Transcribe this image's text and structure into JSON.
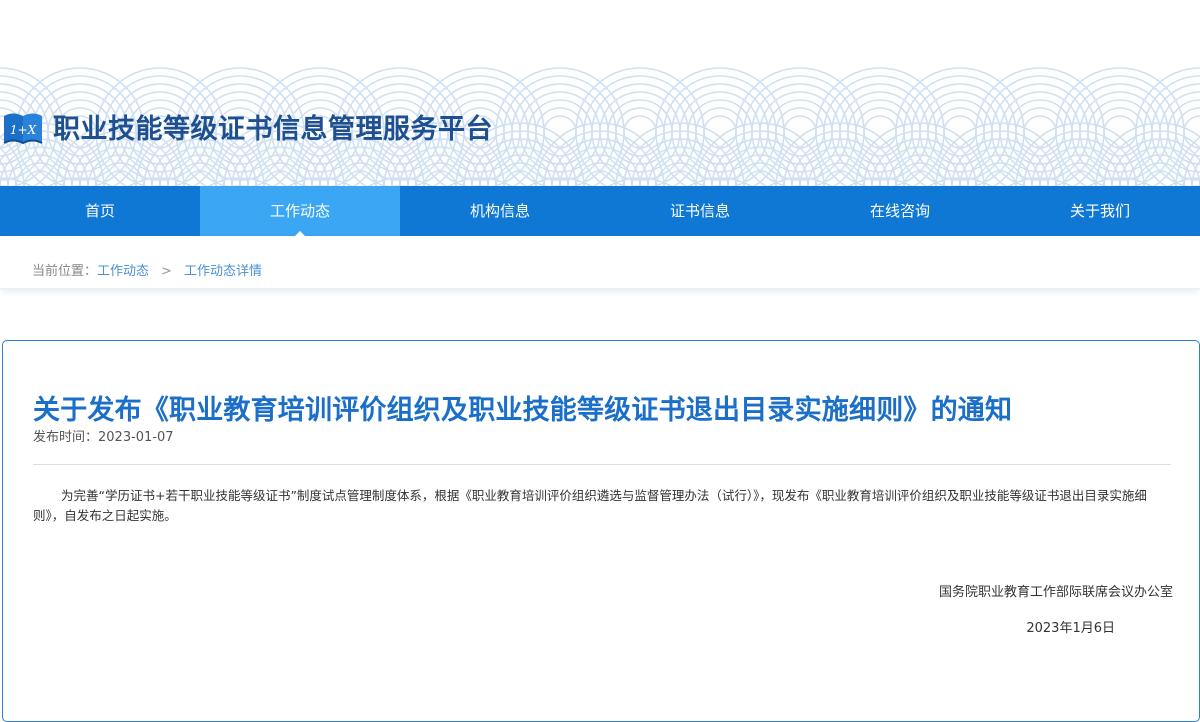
{
  "site": {
    "title": "职业技能等级证书信息管理服务平台",
    "logo_text": "1+X"
  },
  "nav": {
    "items": [
      {
        "label": "首页",
        "active": false
      },
      {
        "label": "工作动态",
        "active": true
      },
      {
        "label": "机构信息",
        "active": false
      },
      {
        "label": "证书信息",
        "active": false
      },
      {
        "label": "在线咨询",
        "active": false
      },
      {
        "label": "关于我们",
        "active": false
      }
    ]
  },
  "breadcrumb": {
    "prefix": "当前位置：",
    "items": [
      "工作动态",
      "工作动态详情"
    ],
    "separator": ">"
  },
  "article": {
    "title": "关于发布《职业教育培训评价组织及职业技能等级证书退出目录实施细则》的通知",
    "publish_label": "发布时间：",
    "publish_date": "2023-01-07",
    "body": "为完善“学历证书+若干职业技能等级证书”制度试点管理制度体系，根据《职业教育培训评价组织遴选与监督管理办法（试行）》，现发布《职业教育培训评价组织及职业技能等级证书退出目录实施细则》，自发布之日起实施。",
    "signature": "国务院职业教育工作部际联席会议办公室",
    "sign_date": "2023年1月6日"
  },
  "colors": {
    "nav_bg": "#0f78d4",
    "nav_active": "#3aa6f4",
    "title_blue": "#1b6fc9",
    "brand_blue": "#1d4f91",
    "link_blue": "#4a90d6"
  }
}
